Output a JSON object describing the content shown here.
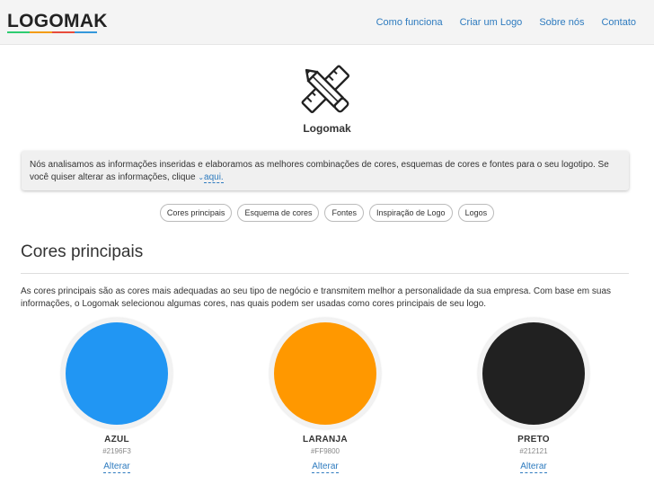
{
  "navbar": {
    "brand": "LOGOMAK",
    "brand_underline_colors": [
      "#2ecc71",
      "#f39c12",
      "#e74c3c",
      "#3498db"
    ],
    "links": [
      "Como funciona",
      "Criar um Logo",
      "Sobre nós",
      "Contato"
    ],
    "link_color": "#2e7bbf"
  },
  "hero": {
    "icon": "pencil-ruler-icon",
    "company_name": "Logomak"
  },
  "info": {
    "text": "Nós analisamos as informações inseridas e elaboramos as melhores combinações de cores, esquemas de cores e fontes para o seu logotipo. Se você quiser alterar as informações, clique",
    "link_label": "aqui."
  },
  "pills": [
    "Cores principais",
    "Esquema de cores",
    "Fontes",
    "Inspiração de Logo",
    "Logos"
  ],
  "section": {
    "title": "Cores principais",
    "description": "As cores principais são as cores mais adequadas ao seu tipo de negócio e transmitem melhor a personalidade da sua empresa. Com base em suas informações, o Logomak selecionou algumas cores, nas quais podem ser usadas como cores principais de seu logo."
  },
  "colors": [
    {
      "name": "AZUL",
      "hex": "#2196F3",
      "action": "Alterar"
    },
    {
      "name": "LARANJA",
      "hex": "#FF9800",
      "action": "Alterar"
    },
    {
      "name": "PRETO",
      "hex": "#212121",
      "action": "Alterar"
    }
  ]
}
